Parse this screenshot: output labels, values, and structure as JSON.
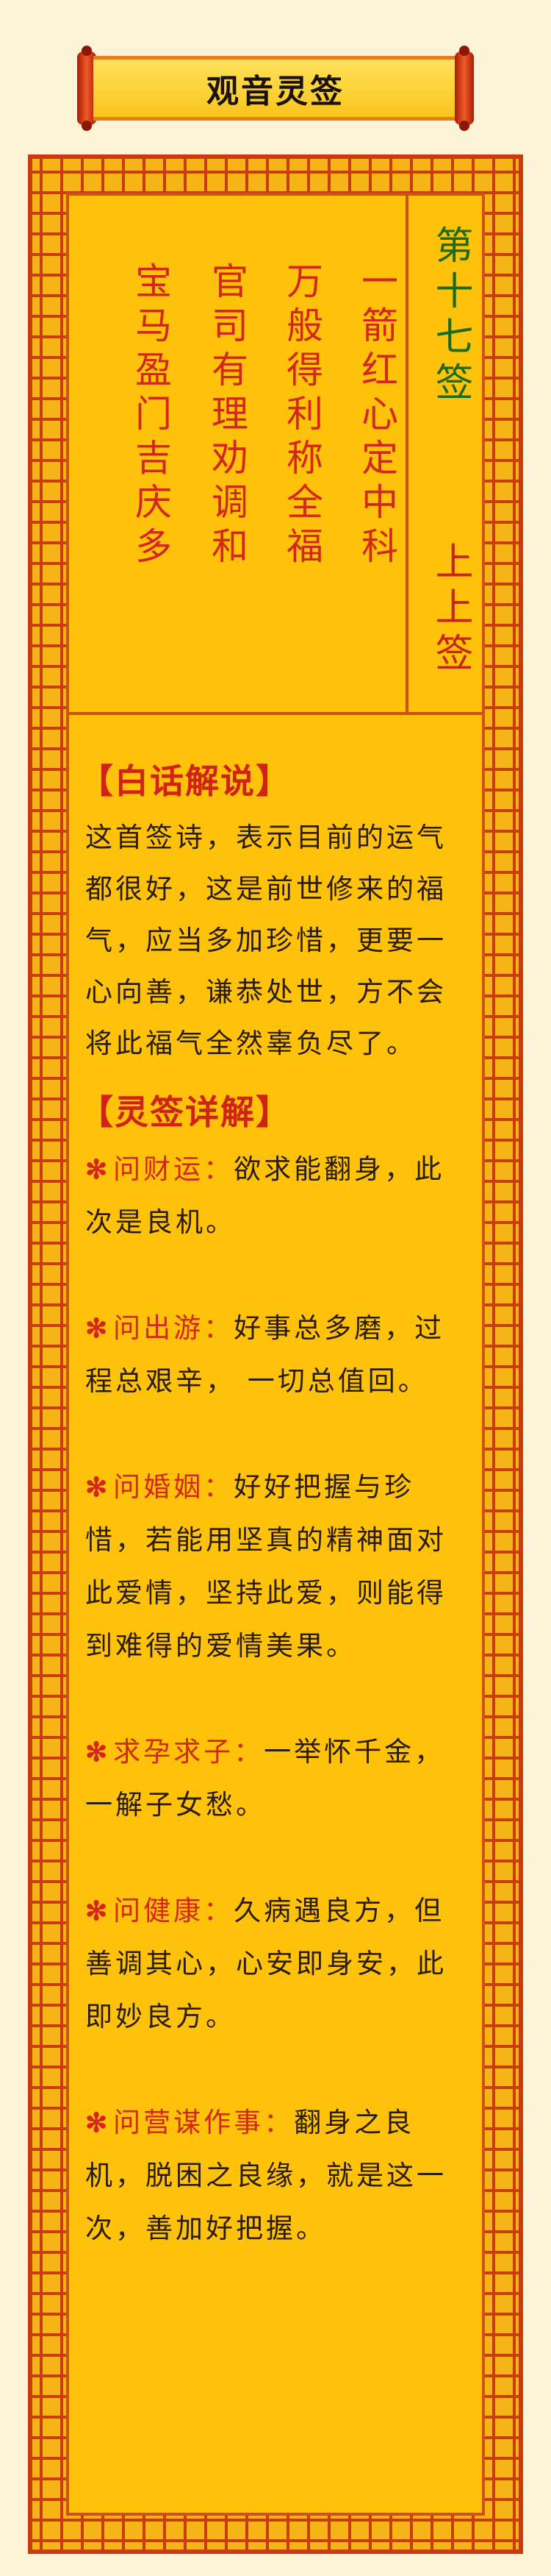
{
  "banner": {
    "title": "观音灵签"
  },
  "poem": {
    "columns": [
      "一箭红心定中科",
      "万般得利称全福",
      "官司有理劝调和",
      "宝马盈门吉庆多"
    ]
  },
  "side": {
    "rank": "第十七签",
    "level": "上上签"
  },
  "explanation": {
    "heading": "【白话解说】",
    "text": "这首签诗，表示目前的运气都很好，这是前世修来的福气，应当多加珍惜，更要一心向善，谦恭处世，方不会将此福气全然辜负尽了。"
  },
  "details": {
    "heading": "【灵签详解】",
    "bullet": "✻",
    "items": [
      {
        "label": "问财运：",
        "text": "欲求能翻身，此次是良机。"
      },
      {
        "label": "问出游：",
        "text": "好事总多磨，过程总艰辛， 一切总值回。"
      },
      {
        "label": "问婚姻：",
        "text": "好好把握与珍惜，若能用坚真的精神面对此爱情，坚持此爱，则能得到难得的爱情美果。"
      },
      {
        "label": "求孕求子：",
        "text": "一举怀千金，一解子女愁。"
      },
      {
        "label": "问健康：",
        "text": "久病遇良方，但善调其心，心安即身安，此即妙良方。"
      },
      {
        "label": "问营谋作事：",
        "text": "翻身之良机，脱困之良缘，就是这一次，善加好把握。"
      }
    ]
  },
  "colors": {
    "background": "#fdf3d6",
    "panel": "#ffc20b",
    "frame": "#c83c0d",
    "accent_red": "#d4271b",
    "accent_green": "#1b6a19"
  }
}
